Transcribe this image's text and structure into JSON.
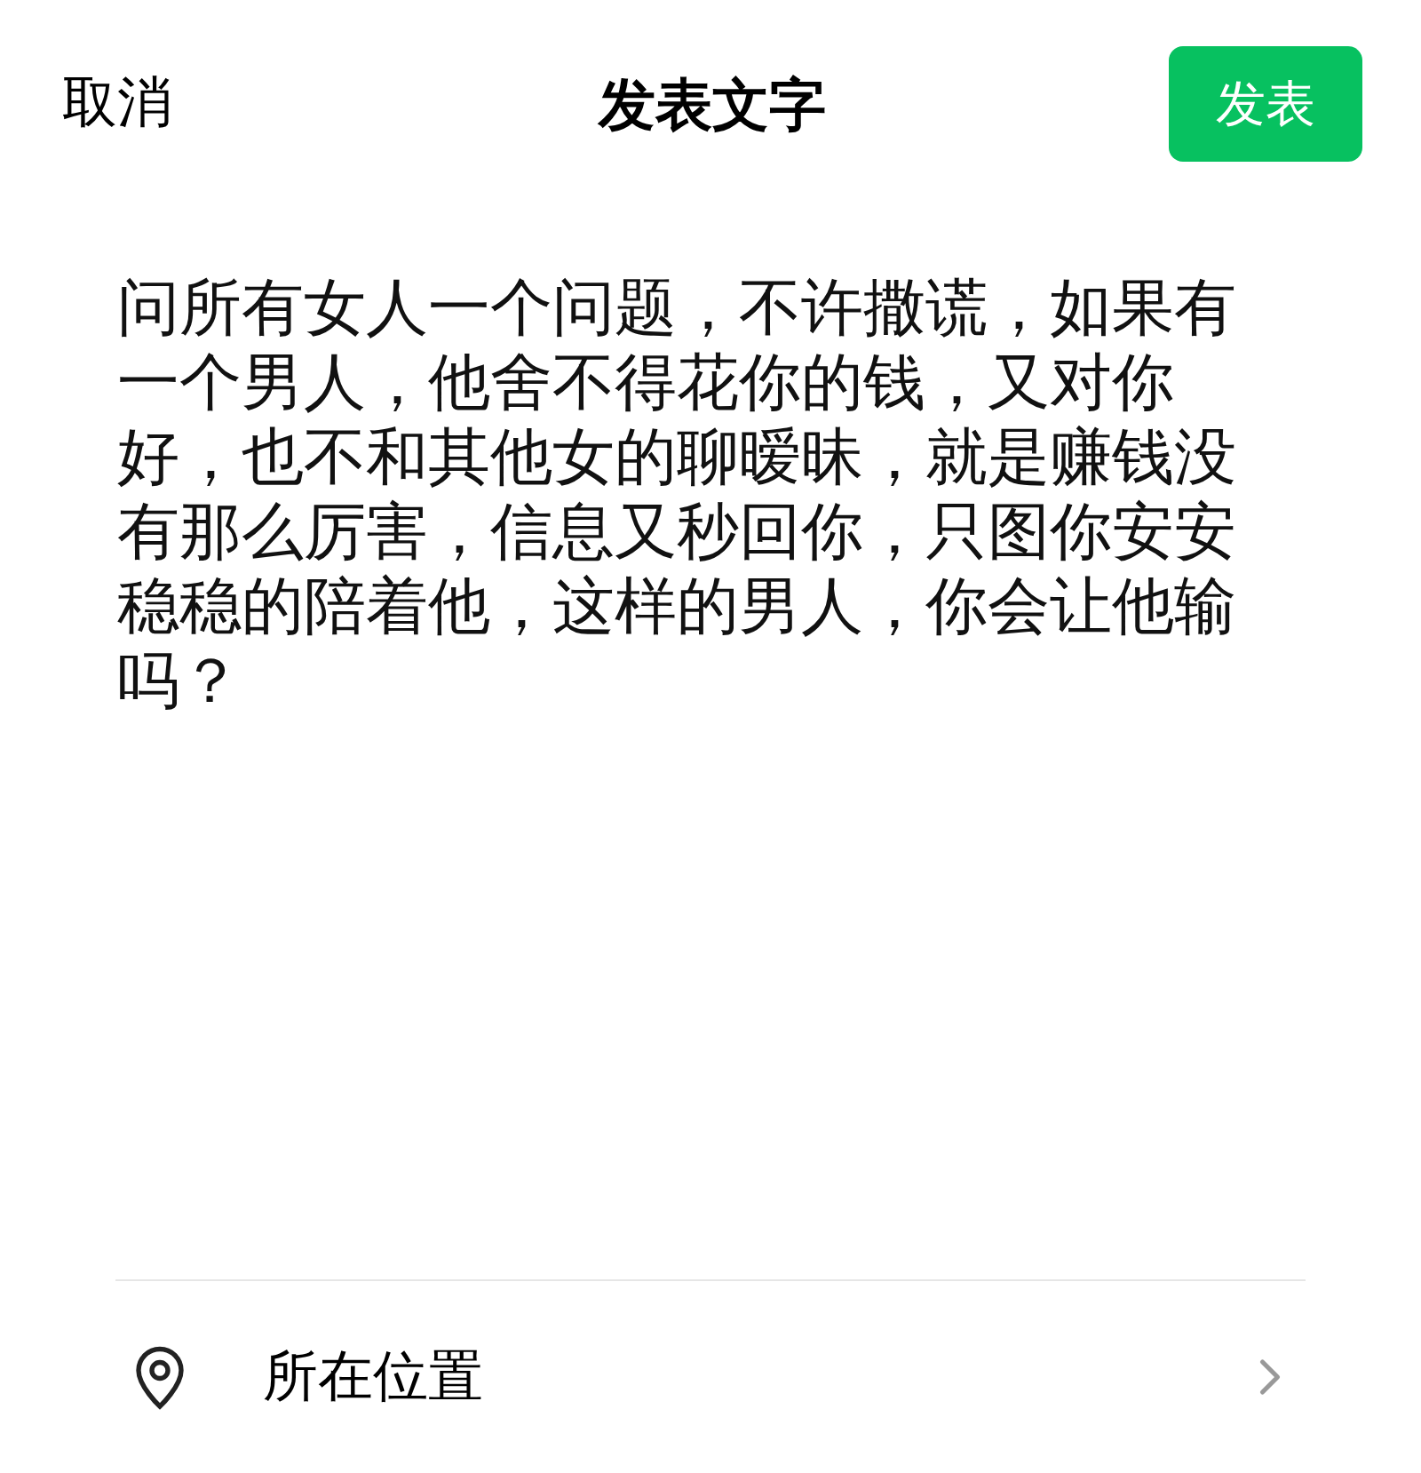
{
  "header": {
    "cancel": "取消",
    "title": "发表文字",
    "publish": "发表"
  },
  "post": {
    "value": "问所有女人一个问题，不许撒谎，如果有一个男人，他舍不得花你的钱，又对你好，也不和其他女的聊暧昧，就是赚钱没有那么厉害，信息又秒回你，只图你安安稳稳的陪着他，这样的男人，你会让他输吗？"
  },
  "location": {
    "label": "所在位置"
  }
}
